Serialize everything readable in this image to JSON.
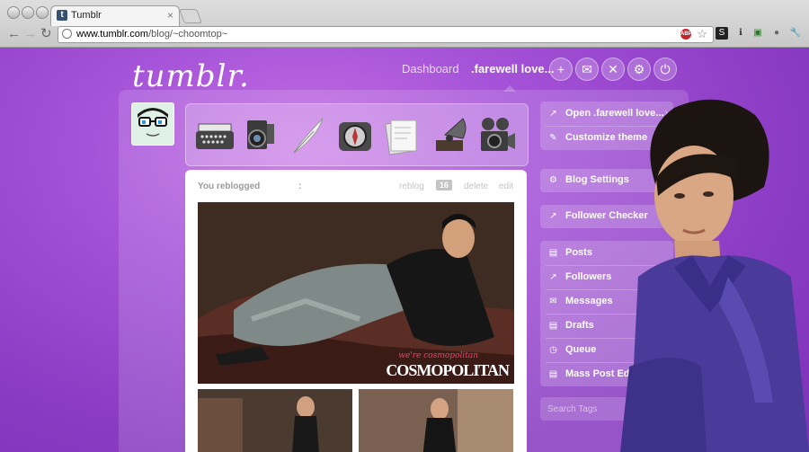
{
  "browser": {
    "tab_title": "Tumblr",
    "tab_favicon": "t",
    "tab_close": "×",
    "url_host": "www.tumblr.com",
    "url_path": "/blog/~choomtop~",
    "back": "←",
    "forward": "→",
    "reload": "↻",
    "adblock_label": "ABP",
    "bookmark_star": "☆",
    "wrench": "🔧"
  },
  "dashboard": {
    "logo": "tumblr.",
    "nav_dashboard": "Dashboard",
    "nav_blog": ".farewell love...",
    "top_icons": [
      "plus-icon",
      "mail-icon",
      "activity-icon",
      "gear-icon",
      "power-icon"
    ]
  },
  "post": {
    "header": "You reblogged",
    "colon": ":",
    "reblog": "reblog",
    "notes": "16",
    "delete": "delete",
    "edit": "edit",
    "magazine_tagline": "we're cosmopolitan",
    "magazine_name": "COSMOPOLITAN"
  },
  "sidebar": {
    "group1": [
      {
        "label": "Open .farewell love...",
        "icon": "external-link-icon"
      },
      {
        "label": "Customize theme",
        "icon": "wrench-icon"
      }
    ],
    "blog_settings": "Blog Settings",
    "follower_checker": "Follower Checker",
    "group2": [
      {
        "label": "Posts",
        "icon": "document-icon"
      },
      {
        "label": "Followers",
        "icon": "chart-icon"
      },
      {
        "label": "Messages",
        "icon": "mail-icon"
      },
      {
        "label": "Drafts",
        "icon": "document-icon"
      },
      {
        "label": "Queue",
        "icon": "clock-icon"
      },
      {
        "label": "Mass Post Editor",
        "icon": "document-icon"
      }
    ],
    "search_placeholder": "Search Tags"
  },
  "colors": {
    "accent": "#8e3fc4",
    "text_light": "#ffffff"
  }
}
